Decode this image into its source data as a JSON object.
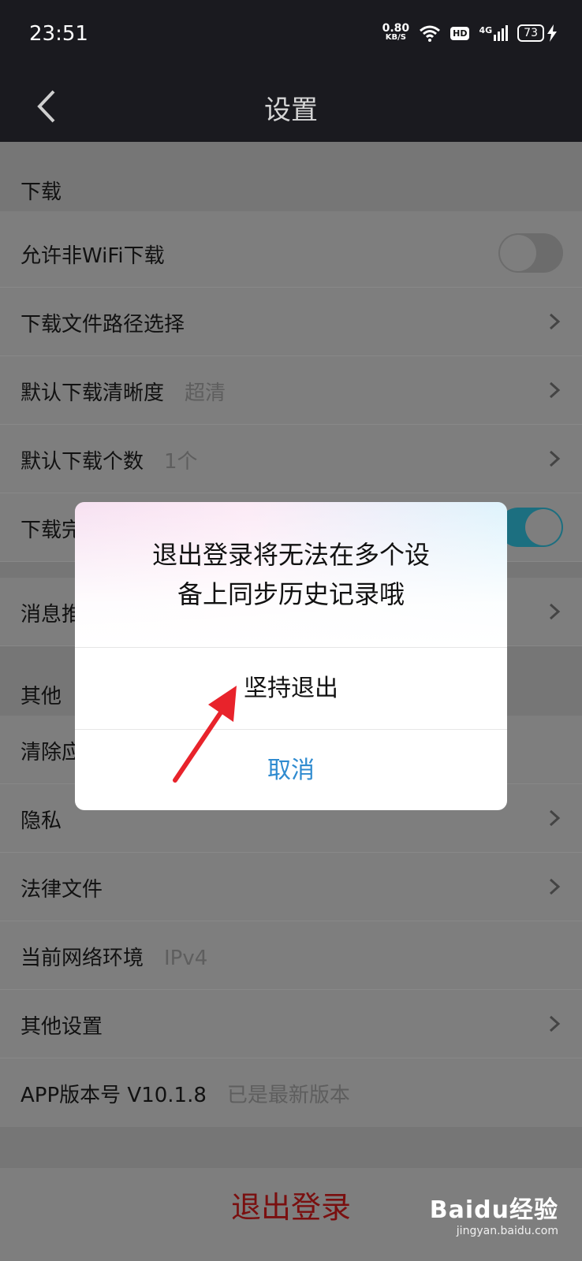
{
  "status": {
    "time": "23:51",
    "speed_value": "0.80",
    "speed_unit": "KB/S",
    "hd": "HD",
    "network": "4G",
    "battery": "73"
  },
  "nav": {
    "title": "设置",
    "back_icon": "chevron-left-icon"
  },
  "sections": {
    "download": "下载",
    "other": "其他"
  },
  "rows": {
    "wifi_download": "允许非WiFi下载",
    "download_path": "下载文件路径选择",
    "default_quality": "默认下载清晰度",
    "default_quality_value": "超清",
    "default_count": "默认下载个数",
    "default_count_value": "1个",
    "download_complete": "下载完",
    "message_push": "消息推",
    "clear_cache": "清除应",
    "privacy": "隐私",
    "legal": "法律文件",
    "network_env": "当前网络环境",
    "network_env_value": "IPv4",
    "other_settings": "其他设置",
    "app_version": "APP版本号 V10.1.8",
    "app_version_status": "已是最新版本"
  },
  "toggles": {
    "wifi_download": false,
    "download_complete": true
  },
  "logout_label": "退出登录",
  "dialog": {
    "message_line1": "退出登录将无法在多个设",
    "message_line2": "备上同步历史记录哦",
    "confirm_label": "坚持退出",
    "cancel_label": "取消"
  },
  "watermark": {
    "main": "Baidu经验",
    "sub": "jingyan.baidu.com"
  },
  "colors": {
    "accent_blue": "#2f8bd0",
    "logout_red": "#7a0f0f",
    "arrow_red": "#e8232b",
    "toggle_on": "#1c6f80"
  }
}
